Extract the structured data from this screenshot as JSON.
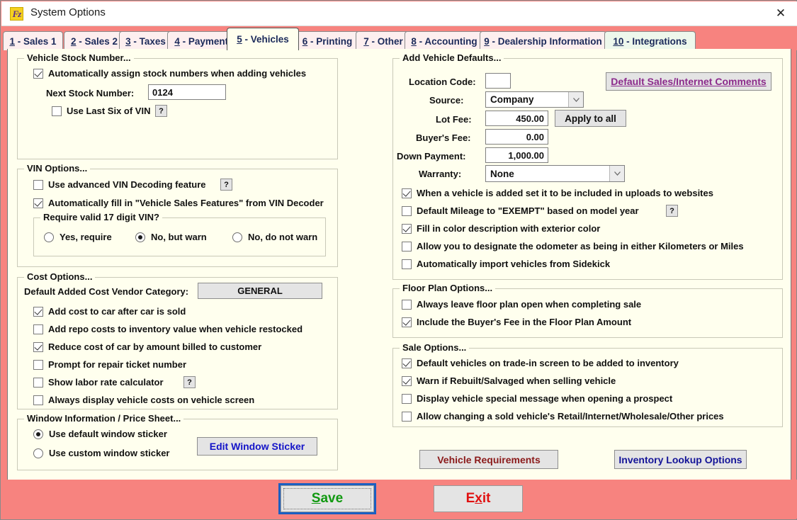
{
  "window": {
    "title": "System Options",
    "icon": "frazer-logo-icon",
    "close_label": "✕",
    "colors": {
      "chrome": "#F7837F",
      "page_bg": "#FFFFEE",
      "tab_inactive": "#FDEFEF",
      "tab_green": "#EEF8EC"
    }
  },
  "tabs": [
    {
      "num": "1",
      "label": "- Sales 1",
      "active": false
    },
    {
      "num": "2",
      "label": "- Sales 2",
      "active": false
    },
    {
      "num": "3",
      "label": "- Taxes",
      "active": false
    },
    {
      "num": "4",
      "label": "- Payments",
      "active": false
    },
    {
      "num": "5",
      "label": "- Vehicles",
      "active": true
    },
    {
      "num": "6",
      "label": "- Printing",
      "active": false
    },
    {
      "num": "7",
      "label": "- Other",
      "active": false
    },
    {
      "num": "8",
      "label": "- Accounting",
      "active": false
    },
    {
      "num": "9",
      "label": "- Dealership Information",
      "active": false
    },
    {
      "num": "10",
      "label": "- Integrations",
      "active": false
    }
  ],
  "left": {
    "stock": {
      "title": "Vehicle Stock Number...",
      "auto_assign": {
        "label": "Automatically assign stock numbers when adding vehicles",
        "checked": true
      },
      "next_stock_label": "Next Stock Number:",
      "next_stock_value": "0124",
      "use_last_six": {
        "label": "Use Last Six of VIN",
        "checked": false
      },
      "help": "?"
    },
    "vin": {
      "title": "VIN Options...",
      "advanced": {
        "label": "Use advanced VIN Decoding feature",
        "checked": false
      },
      "advanced_help": "?",
      "autofill": {
        "label": "Automatically fill in \"Vehicle Sales Features\" from VIN Decoder",
        "checked": true
      },
      "require_title": "Require valid 17 digit VIN?",
      "require_options": [
        {
          "label": "Yes, require",
          "selected": false
        },
        {
          "label": "No, but warn",
          "selected": true
        },
        {
          "label": "No, do not warn",
          "selected": false
        }
      ]
    },
    "cost": {
      "title": "Cost Options...",
      "vendor_label": "Default Added Cost Vendor Category:",
      "vendor_value": "GENERAL",
      "items": [
        {
          "label": "Add cost to car after car is sold",
          "checked": true
        },
        {
          "label": "Add repo costs to inventory value when vehicle restocked",
          "checked": false
        },
        {
          "label": "Reduce cost of car by amount billed to customer",
          "checked": true
        },
        {
          "label": "Prompt for repair ticket number",
          "checked": false
        },
        {
          "label": "Show labor rate calculator",
          "checked": false
        },
        {
          "label": "Always display vehicle costs on vehicle screen",
          "checked": false
        }
      ],
      "labor_help": "?"
    },
    "window_info": {
      "title": "Window Information / Price Sheet...",
      "options": [
        {
          "label": "Use default window sticker",
          "selected": true
        },
        {
          "label": "Use custom window sticker",
          "selected": false
        }
      ],
      "edit_button": "Edit Window Sticker"
    }
  },
  "right": {
    "defaults": {
      "title": "Add Vehicle Defaults...",
      "location_code_label": "Location Code:",
      "location_code_value": "",
      "source_label": "Source:",
      "source_value": "Company",
      "lot_fee_label": "Lot Fee:",
      "lot_fee_value": "450.00",
      "apply_all_button": "Apply to all",
      "buyers_fee_label": "Buyer's Fee:",
      "buyers_fee_value": "0.00",
      "down_payment_label": "Down Payment:",
      "down_payment_value": "1,000.00",
      "warranty_label": "Warranty:",
      "warranty_value": "None",
      "comments_button": "Default Sales/Internet Comments",
      "checks": [
        {
          "label": "When a vehicle is added set it to be included in uploads to websites",
          "checked": true
        },
        {
          "label": "Default Mileage to \"EXEMPT\" based on model year",
          "checked": false
        },
        {
          "label": "Fill in color description with exterior color",
          "checked": true
        },
        {
          "label": "Allow you to designate the odometer as being in either Kilometers or Miles",
          "checked": false
        },
        {
          "label": "Automatically import vehicles from Sidekick",
          "checked": false
        }
      ],
      "mileage_help": "?"
    },
    "floorplan": {
      "title": "Floor Plan Options...",
      "items": [
        {
          "label": "Always leave floor plan open when completing sale",
          "checked": false
        },
        {
          "label": "Include the Buyer's Fee in the Floor Plan Amount",
          "checked": true
        }
      ]
    },
    "sale": {
      "title": "Sale Options...",
      "items": [
        {
          "label": "Default vehicles on trade-in screen to be added to inventory",
          "checked": true
        },
        {
          "label": "Warn if Rebuilt/Salvaged when selling vehicle",
          "checked": true
        },
        {
          "label": "Display vehicle special message when opening a prospect",
          "checked": false
        },
        {
          "label": "Allow changing a sold vehicle's Retail/Internet/Wholesale/Other prices",
          "checked": false
        }
      ]
    },
    "vehicle_requirements_button": "Vehicle Requirements",
    "inventory_lookup_button": "Inventory Lookup Options"
  },
  "footer": {
    "save_label": "Save",
    "save_accel": "S",
    "exit_label": "Exit",
    "exit_accel": "x"
  }
}
